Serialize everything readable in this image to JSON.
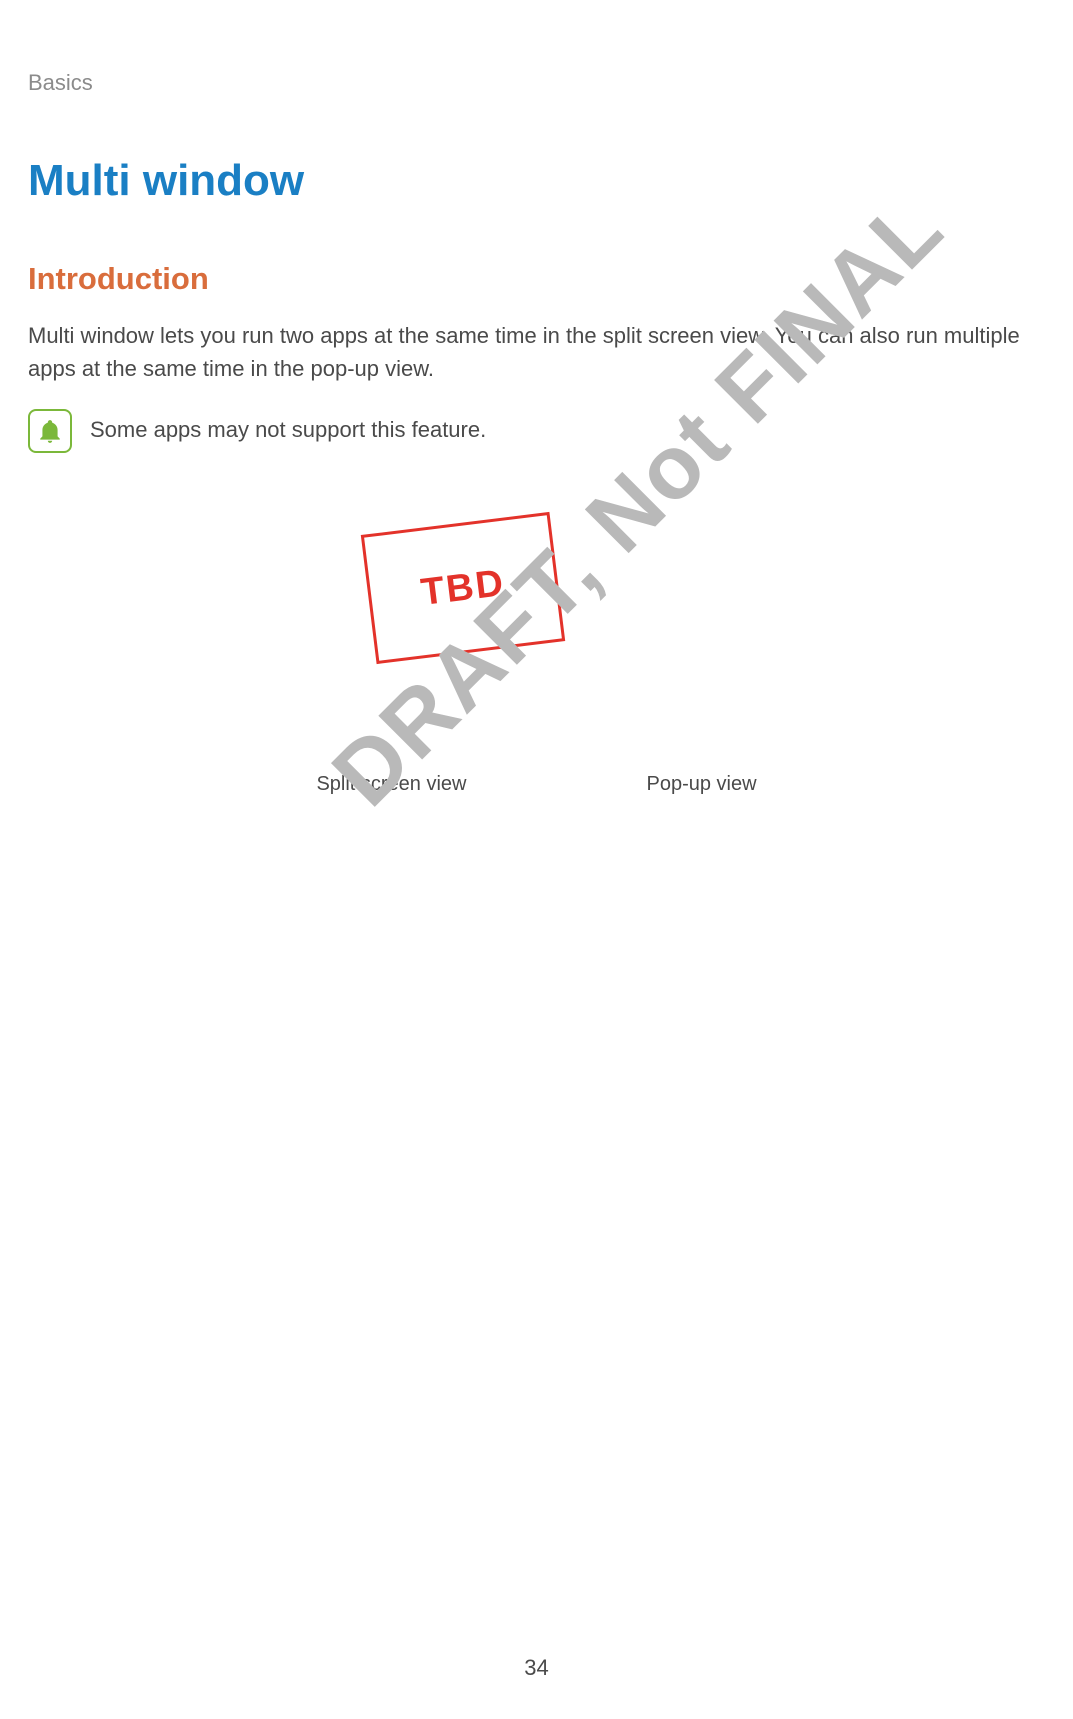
{
  "breadcrumb": "Basics",
  "title": "Multi window",
  "subtitle": "Introduction",
  "body": "Multi window lets you run two apps at the same time in the split screen view. You can also run multiple apps at the same time in the pop-up view.",
  "note": "Some apps may not support this feature.",
  "tbd": "TBD",
  "captions": {
    "left": "Split screen view",
    "right": "Pop-up view"
  },
  "watermark": "DRAFT, Not FINAL",
  "pageNumber": "34"
}
